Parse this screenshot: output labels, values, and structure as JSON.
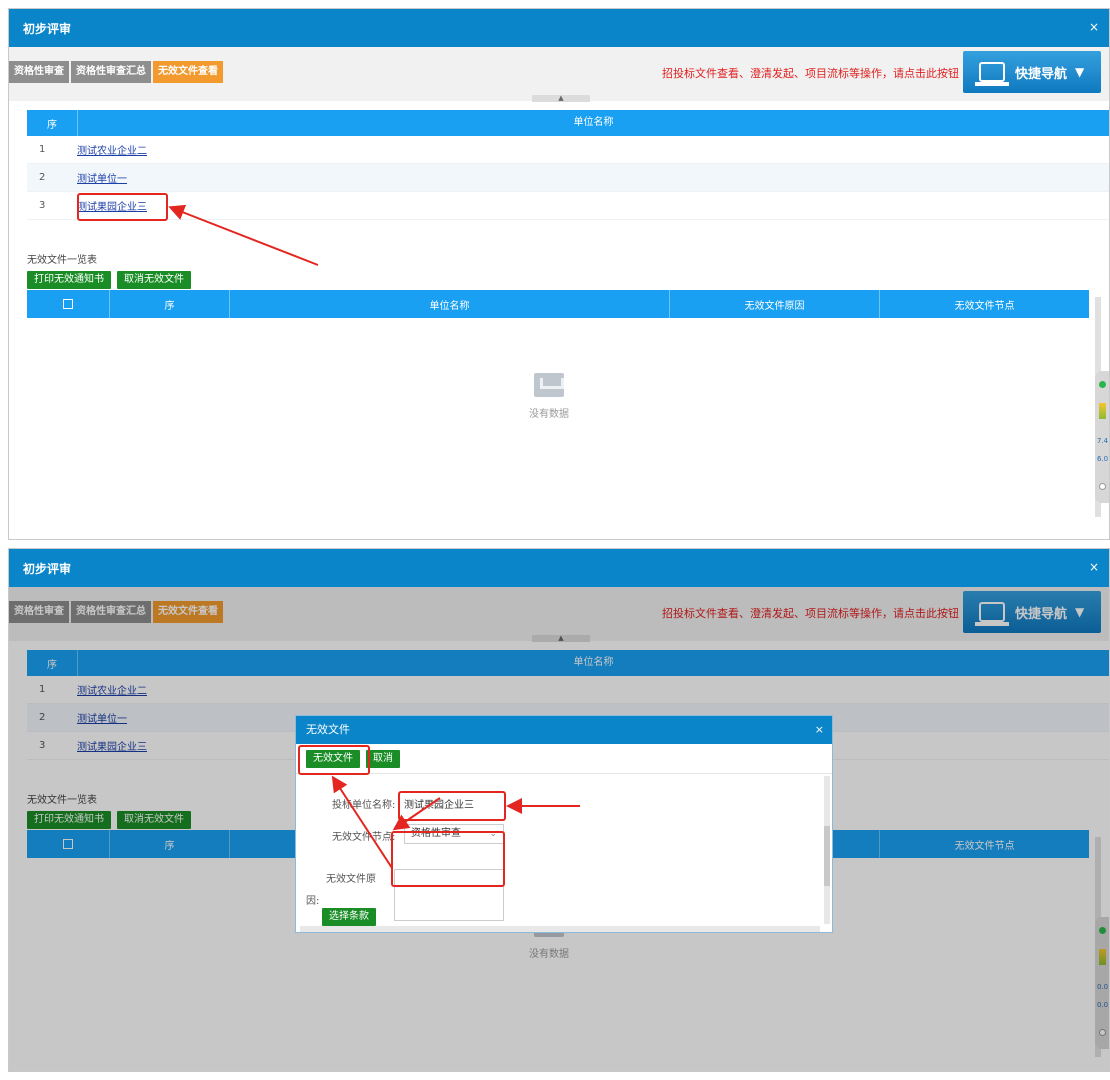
{
  "window_title": "初步评审",
  "close_glyph": "×",
  "tabs": [
    "资格性审查",
    "资格性审查汇总",
    "无效文件查看"
  ],
  "hint": "招投标文件查看、澄清发起、项目流标等操作，请点击此按钮",
  "quick_nav": "快捷导航",
  "collapse_glyph": "▲",
  "unit_table": {
    "headers": [
      "序",
      "单位名称"
    ],
    "rows": [
      {
        "no": "1",
        "name": "测试农业企业二"
      },
      {
        "no": "2",
        "name": "测试单位一"
      },
      {
        "no": "3",
        "name": "测试果园企业三"
      }
    ]
  },
  "invalid_section": {
    "title": "无效文件一览表",
    "buttons": [
      "打印无效通知书",
      "取消无效文件"
    ],
    "headers": [
      "序",
      "单位名称",
      "无效文件原因",
      "无效文件节点"
    ],
    "empty_text": "没有数据"
  },
  "side_widget_1": [
    "7.4",
    "6.0"
  ],
  "side_widget_2": [
    "0.0",
    "0.0"
  ],
  "modal": {
    "title": "无效文件",
    "confirm_button": "无效文件",
    "cancel_button": "取消",
    "bidder_label": "投标单位名称:",
    "bidder_value": "测试果园企业三",
    "node_label": "无效文件节点:",
    "node_value": "资格性审查",
    "reason_label_1": "无效文件原",
    "reason_label_2": "因:",
    "choose_clause_button": "选择条款"
  },
  "colors": {
    "header_blue": "#0a85c9",
    "table_blue": "#1aa0f2",
    "tab_active": "#f29a2e",
    "tab_inactive": "#8e8e8e",
    "button_green": "#1a8d26",
    "hint_red": "#e02020",
    "annotation_red": "#e3261f"
  }
}
